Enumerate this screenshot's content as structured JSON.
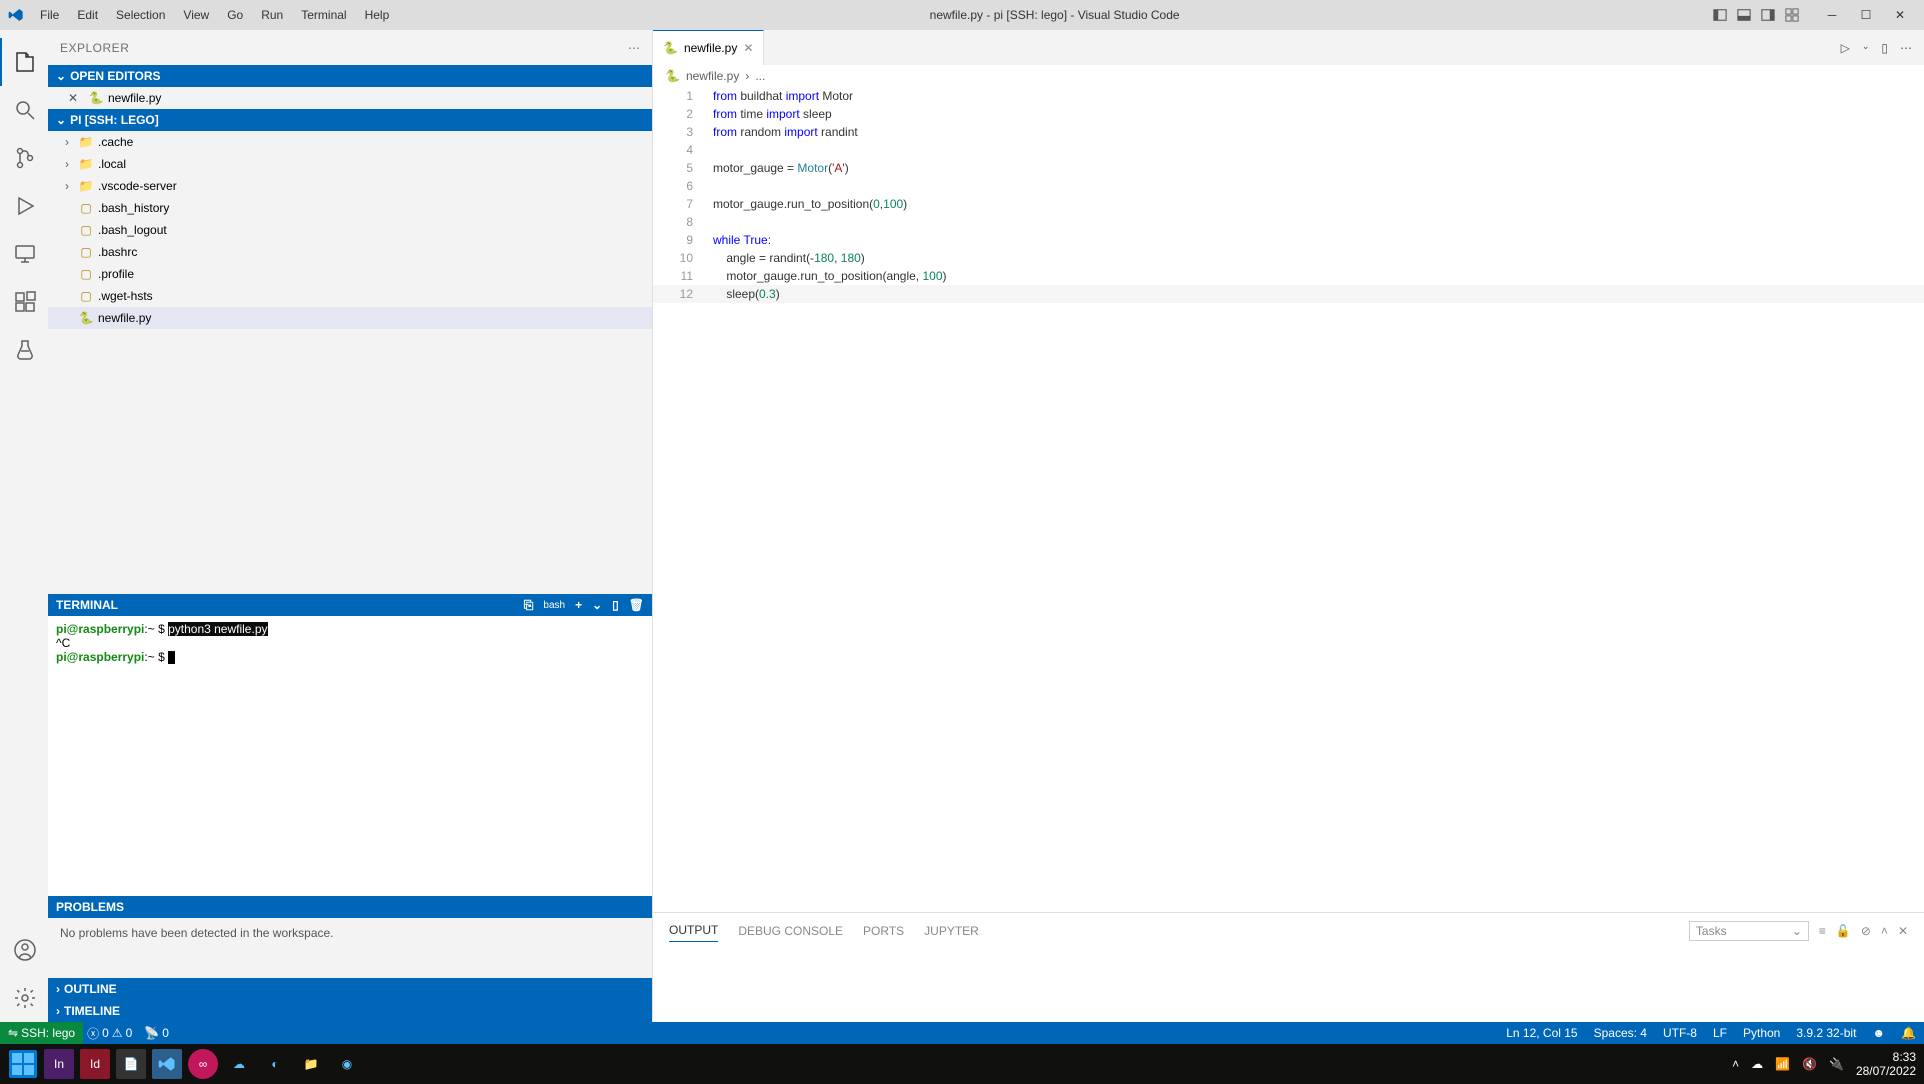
{
  "titlebar": {
    "menus": [
      "File",
      "Edit",
      "Selection",
      "View",
      "Go",
      "Run",
      "Terminal",
      "Help"
    ],
    "title": "newfile.py - pi [SSH: lego] - Visual Studio Code"
  },
  "sidebar": {
    "header": "EXPLORER",
    "open_editors": {
      "label": "OPEN EDITORS",
      "items": [
        {
          "name": "newfile.py"
        }
      ]
    },
    "folder": {
      "label": "PI [SSH: LEGO]",
      "tree": [
        {
          "type": "folder",
          "name": ".cache",
          "expanded": false
        },
        {
          "type": "folder",
          "name": ".local",
          "expanded": false
        },
        {
          "type": "folder",
          "name": ".vscode-server",
          "expanded": false
        },
        {
          "type": "file",
          "name": ".bash_history",
          "icon": "file"
        },
        {
          "type": "file",
          "name": ".bash_logout",
          "icon": "file"
        },
        {
          "type": "file",
          "name": ".bashrc",
          "icon": "file"
        },
        {
          "type": "file",
          "name": ".profile",
          "icon": "file"
        },
        {
          "type": "file",
          "name": ".wget-hsts",
          "icon": "file"
        },
        {
          "type": "file",
          "name": "newfile.py",
          "icon": "python",
          "selected": true
        }
      ]
    },
    "terminal": {
      "label": "TERMINAL",
      "shell": "bash",
      "prompt1_user": "pi@raspberrypi",
      "prompt1_path": ":~ $ ",
      "command": "python3 newfile.py",
      "line2": "^C",
      "prompt2_user": "pi@raspberrypi",
      "prompt2_path": ":~ $ "
    },
    "problems": {
      "label": "PROBLEMS",
      "body": "No problems have been detected in the workspace."
    },
    "outline": "OUTLINE",
    "timeline": "TIMELINE"
  },
  "editor": {
    "tab": {
      "name": "newfile.py"
    },
    "breadcrumb": {
      "file": "newfile.py",
      "sep": "›",
      "more": "..."
    },
    "lines": [
      {
        "n": 1,
        "segs": [
          [
            "kw",
            "from"
          ],
          [
            "",
            " buildhat "
          ],
          [
            "kw",
            "import"
          ],
          [
            "",
            " Motor"
          ]
        ]
      },
      {
        "n": 2,
        "segs": [
          [
            "kw",
            "from"
          ],
          [
            "",
            " time "
          ],
          [
            "kw",
            "import"
          ],
          [
            "",
            " sleep"
          ]
        ]
      },
      {
        "n": 3,
        "segs": [
          [
            "kw",
            "from"
          ],
          [
            "",
            " random "
          ],
          [
            "kw",
            "import"
          ],
          [
            "",
            " randint"
          ]
        ]
      },
      {
        "n": 4,
        "segs": []
      },
      {
        "n": 5,
        "segs": [
          [
            "",
            "motor_gauge = "
          ],
          [
            "cls",
            "Motor"
          ],
          [
            "",
            "("
          ],
          [
            "str",
            "'A'"
          ],
          [
            "",
            ")"
          ]
        ]
      },
      {
        "n": 6,
        "segs": []
      },
      {
        "n": 7,
        "segs": [
          [
            "",
            "motor_gauge.run_to_position("
          ],
          [
            "num",
            "0"
          ],
          [
            "",
            ","
          ],
          [
            "num",
            "100"
          ],
          [
            "",
            ")"
          ]
        ]
      },
      {
        "n": 8,
        "segs": []
      },
      {
        "n": 9,
        "segs": [
          [
            "kw",
            "while"
          ],
          [
            "",
            " "
          ],
          [
            "kw",
            "True"
          ],
          [
            "",
            ":"
          ]
        ]
      },
      {
        "n": 10,
        "segs": [
          [
            "",
            "    angle = randint(-"
          ],
          [
            "num",
            "180"
          ],
          [
            "",
            ", "
          ],
          [
            "num",
            "180"
          ],
          [
            "",
            ")"
          ]
        ]
      },
      {
        "n": 11,
        "segs": [
          [
            "",
            "    motor_gauge.run_to_position(angle, "
          ],
          [
            "num",
            "100"
          ],
          [
            "",
            ")"
          ]
        ]
      },
      {
        "n": 12,
        "segs": [
          [
            "",
            "    sleep("
          ],
          [
            "num",
            "0.3"
          ],
          [
            "",
            ")"
          ]
        ],
        "current": true
      }
    ]
  },
  "panel": {
    "tabs": [
      "OUTPUT",
      "DEBUG CONSOLE",
      "PORTS",
      "JUPYTER"
    ],
    "active": 0,
    "filter": "Tasks"
  },
  "statusbar": {
    "remote": "SSH: lego",
    "errors": "0",
    "warnings": "0",
    "ports": "0",
    "cursor": "Ln 12, Col 15",
    "spaces": "Spaces: 4",
    "encoding": "UTF-8",
    "eol": "LF",
    "lang": "Python",
    "interpreter": "3.9.2 32-bit"
  },
  "taskbar": {
    "time": "8:33",
    "date": "28/07/2022"
  }
}
